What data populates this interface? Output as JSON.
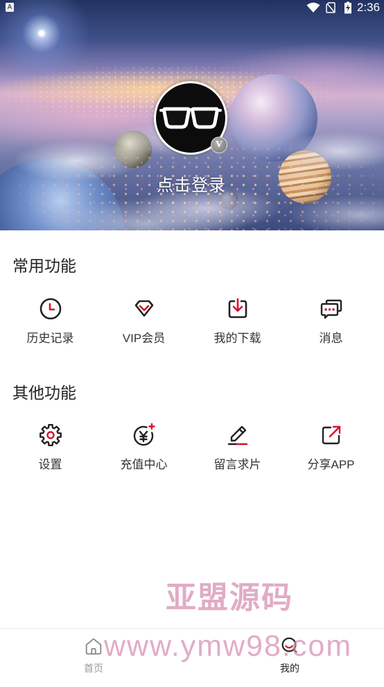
{
  "status_bar": {
    "notification_label": "A",
    "time": "2:36",
    "icons": [
      "wifi-icon",
      "no-sim-icon",
      "battery-charging-icon"
    ]
  },
  "profile": {
    "login_label": "点击登录",
    "badge_label": "V",
    "avatar_icon": "sunglasses-icon"
  },
  "common": {
    "title": "常用功能",
    "items": [
      {
        "label": "历史记录",
        "icon": "clock-icon"
      },
      {
        "label": "VIP会员",
        "icon": "diamond-icon"
      },
      {
        "label": "我的下载",
        "icon": "download-icon"
      },
      {
        "label": "消息",
        "icon": "message-icon"
      }
    ]
  },
  "other": {
    "title": "其他功能",
    "items": [
      {
        "label": "设置",
        "icon": "gear-icon"
      },
      {
        "label": "充值中心",
        "icon": "yen-coin-icon"
      },
      {
        "label": "留言求片",
        "icon": "edit-icon"
      },
      {
        "label": "分享APP",
        "icon": "share-icon"
      }
    ]
  },
  "nav": {
    "items": [
      {
        "label": "首页",
        "icon": "home-icon",
        "active": false
      },
      {
        "label": "我的",
        "icon": "profile-icon",
        "active": true
      }
    ]
  },
  "watermark": {
    "brand": "亚盟源码",
    "url": "www.ymw98.com"
  },
  "colors": {
    "accent": "#d7102c",
    "icon_stroke": "#222222",
    "label_text": "#333333",
    "nav_inactive": "#999999"
  }
}
